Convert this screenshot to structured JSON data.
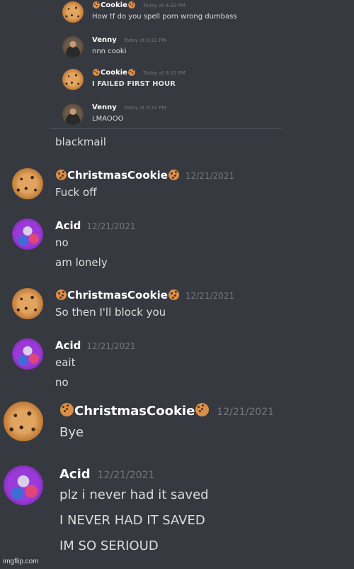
{
  "embedded": {
    "messages": [
      {
        "user": "Cookie",
        "timestamp": "",
        "text": "How tf do you spell porn wrong dumbass",
        "bold": false
      },
      {
        "user": "Venny",
        "timestamp": "Today at 6:32 PM",
        "text": "nnn cooki",
        "bold": false
      },
      {
        "user": "Cookie",
        "timestamp": "Today at 6:32 PM",
        "text": "I FAILED FIRST HOUR",
        "bold": true
      },
      {
        "user": "Venny",
        "timestamp": "Today at 6:32 PM",
        "text": "LMAOOO",
        "bold": false
      }
    ],
    "first_timestamp": "Today at 6:32 PM"
  },
  "caption": "blackmail",
  "messages": [
    {
      "user": "ChristmasCookie",
      "timestamp": "12/21/2021",
      "lines": [
        "Fuck off"
      ]
    },
    {
      "user": "Acid",
      "timestamp": "12/21/2021",
      "lines": [
        "no",
        "am lonely"
      ]
    },
    {
      "user": "ChristmasCookie",
      "timestamp": "12/21/2021",
      "lines": [
        "So then I'll block you"
      ]
    },
    {
      "user": "Acid",
      "timestamp": "12/21/2021",
      "lines": [
        "eait",
        "no"
      ]
    },
    {
      "user": "ChristmasCookie",
      "timestamp": "12/21/2021",
      "lines": [
        "Bye"
      ]
    },
    {
      "user": "Acid",
      "timestamp": "12/21/2021",
      "lines": [
        "plz i never had it saved",
        "I NEVER HAD IT SAVED",
        "IM SO SERIOUD"
      ]
    }
  ],
  "watermark": "imgflip.com",
  "colors": {
    "background": "#36393f",
    "username": "#ffffff",
    "text": "#dcddde",
    "timestamp": "#72767d"
  },
  "icons": {
    "cookie_avatar": "cookie-avatar-icon",
    "acid_avatar": "acid-avatar-icon",
    "venny_avatar": "venny-avatar-icon",
    "cookie_emoji": "cookie-emoji-icon"
  }
}
